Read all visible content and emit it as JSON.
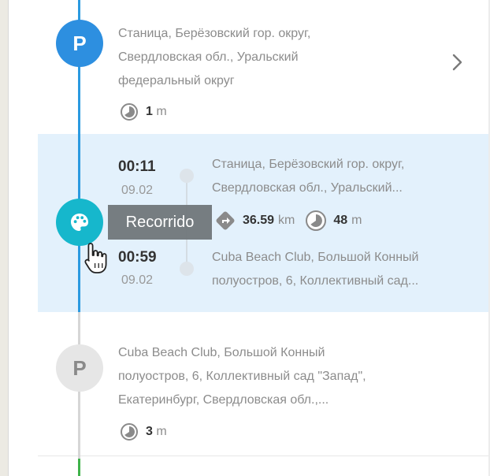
{
  "timeline": [
    {
      "kind": "parking",
      "marker": "P",
      "address": [
        "Станица, Берёзовский гор. округ,",
        "Свердловская обл., Уральский",
        "федеральный округ"
      ],
      "duration_value": "1",
      "duration_unit": "m",
      "expand_icon": "chevron-right-icon"
    },
    {
      "kind": "trip",
      "marker_icon": "palette-icon",
      "start_time": "00:11",
      "start_date": "09.02",
      "end_time": "00:59",
      "end_date": "09.02",
      "start_address": [
        "Станица, Берёзовский гор. округ,",
        "Свердловская обл., Уральский..."
      ],
      "end_address": [
        "Cuba Beach Club, Большой Конный",
        "полуостров, 6, Коллективный сад..."
      ],
      "distance_value": "36.59",
      "distance_unit": "km",
      "duration_value": "48",
      "duration_unit": "m",
      "tooltip": "Recorrido"
    },
    {
      "kind": "parking",
      "marker": "P",
      "address": [
        "Cuba Beach Club, Большой Конный",
        "полуостров, 6, Коллективный сад \"Запад\",",
        "Екатеринбург, Свердловская обл.,..."
      ],
      "duration_value": "3",
      "duration_unit": "m"
    }
  ],
  "colors": {
    "parking_active": "#2d8fe0",
    "trip_marker": "#16b7cc",
    "parking_inactive": "#e6e6e6",
    "selected_row": "#e3f1fc",
    "timeline_blue": "#2b9ae0",
    "timeline_green": "#3fb24a"
  }
}
